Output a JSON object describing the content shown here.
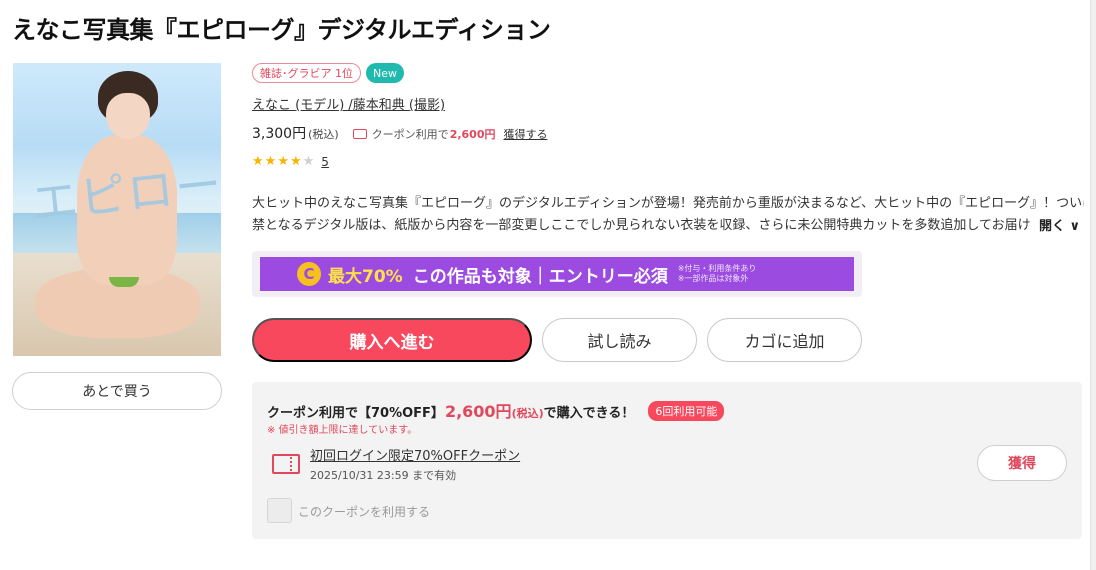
{
  "product": {
    "title": "えなこ写真集『エピローグ』デジタルエディション",
    "cover_logo": "エピローグ",
    "tags": {
      "rank": "雑誌･グラビア 1位",
      "new": "New"
    },
    "authors": "えなこ (モデル) /藤本和典 (撮影)",
    "price": "3,300円",
    "price_tax": "(税込)",
    "coupon_prefix": "クーポン利用で",
    "coupon_price": "2,600円",
    "coupon_get": "獲得する",
    "rating": 4,
    "rating_max": 5,
    "review_count": "5",
    "description": [
      "大ヒット中のえなこ写真集『エピローグ』のデジタルエディションが登場！発売前から重版が決まるなど、大ヒット中の『エピローグ』！ついに解",
      "禁となるデジタル版は、紙版から内容を一部変更しここでしか見られない衣装を収録、さらに未公開特典カットを多数追加してお届け"
    ],
    "more_label": "開く ∨"
  },
  "banner": {
    "icon": "C",
    "percent": "最大70%",
    "main": "この作品も対象｜エントリー必須",
    "note1": "※付与・利用条件あり",
    "note2": "※一部作品は対象外"
  },
  "actions": {
    "later": "あとで買う",
    "buy": "購入へ進む",
    "trial": "試し読み",
    "cart": "カゴに追加"
  },
  "coupon_panel": {
    "head_a": "クーポン利用で【70%OFF】",
    "head_price": "2,600円",
    "head_tax": "(税込)",
    "head_b": "で購入できる！",
    "badge": "6回利用可能",
    "note": "※ 値引き額上限に達しています。",
    "coupon_name": "初回ログイン限定70%OFFクーポン",
    "expiry": "2025/10/31 23:59 まで有効",
    "get_label": "獲得",
    "use_label": "このクーポンを利用する"
  },
  "colors": {
    "accent": "#f8485e",
    "banner": "#9b4be0",
    "badge_new": "#1fb9b0",
    "star": "#f7b500"
  }
}
